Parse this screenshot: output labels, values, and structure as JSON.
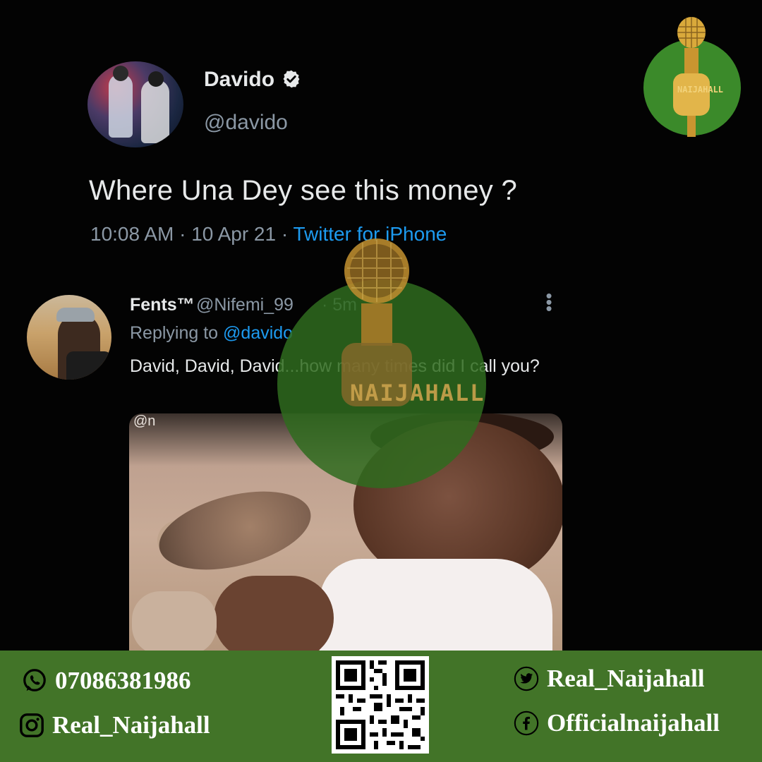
{
  "tweet": {
    "author_name": "Davido",
    "author_handle": "@davido",
    "text": "Where Una Dey see this money ?",
    "time": "10:08 AM",
    "date": "10 Apr 21",
    "source": "Twitter for iPhone"
  },
  "reply": {
    "name": "Fents™",
    "handle": "@Nifemi_99",
    "time": "5m",
    "replying_prefix": "Replying to",
    "replying_to": "@davido",
    "text": "David, David, David...how many times did I call you?",
    "media_watermark": "@n"
  },
  "watermark": {
    "text": "NAIJAHALL"
  },
  "logo": {
    "text": "NAIJAHALL"
  },
  "footer": {
    "phone": "07086381986",
    "instagram": "Real_Naijahall",
    "twitter": "Real_Naijahall",
    "facebook": "Officialnaijahall"
  },
  "colors": {
    "background": "#030303",
    "accent_blue": "#1d9bf0",
    "footer_green": "#427428",
    "logo_green": "#3b8a2a",
    "muted_text": "#8b98a5"
  },
  "icons": {
    "verified": "verified-badge-icon",
    "more": "more-vertical-icon",
    "whatsapp": "whatsapp-icon",
    "instagram": "instagram-icon",
    "twitter": "twitter-icon",
    "facebook": "facebook-icon"
  }
}
